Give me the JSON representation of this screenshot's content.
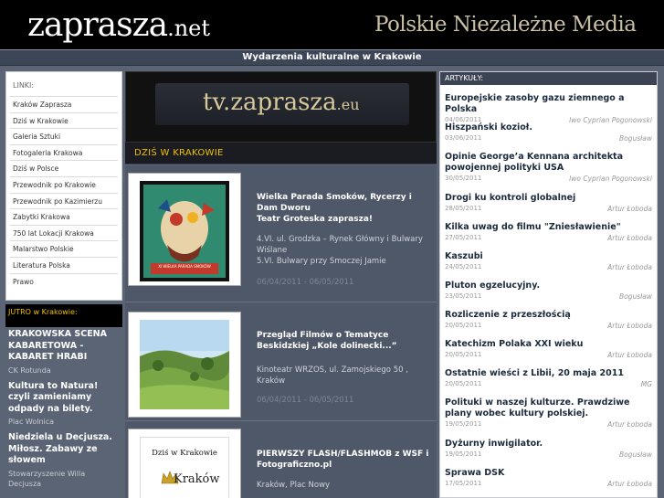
{
  "header": {
    "logo_main": "zaprasza",
    "logo_tld": ".net",
    "slogan": "Polskie Niezależne Media",
    "subtitle": "Wydarzenia kulturalne w Krakowie"
  },
  "links": {
    "title": "LINKI:",
    "items": [
      "Kraków Zaprasza",
      "Dziś w Krakowie",
      "Galeria Sztuki",
      "Fotogaleria Krakowa",
      "Dziś w Polsce",
      "Przewodnik po Krakowie",
      "Przewodnik po Kazimierzu",
      "Zabytki Krakowa",
      "750 lat Lokacji Krakowa",
      "Malarstwo Polskie",
      "Literatura Polska",
      "Prawo"
    ]
  },
  "jutro": {
    "title": "JUTRO w Krakowie:",
    "events": [
      {
        "title": "KRAKOWSKA SCENA KABARETOWA - KABARET HRABI",
        "place": "CK Rotunda"
      },
      {
        "title": "Kultura to Natura! czyli zamieniamy odpady na bilety.",
        "place": "Plac Wolnica"
      },
      {
        "title": "Niedziela u Decjusza. Miłosz. Zabawy ze słowem",
        "place": "Stowarzyszenie Willa Decjusza"
      }
    ]
  },
  "tv": {
    "main": "tv.zaprasza",
    "tld": ".eu"
  },
  "dzis": {
    "title": "DZIŚ W KRAKOWIE",
    "items": [
      {
        "title": "Wielka Parada Smoków, Rycerzy i Dam Dworu",
        "subtitle": "Teatr Groteska zaprasza!",
        "desc": "4.VI. ul. Grodzka – Rynek Główny i Bulwary Wiślane\n5.VI. Bulwary przy Smoczej Jamie",
        "date": "06/04/2011  -  06/05/2011",
        "thumb_caption": "XI WIELKA PARADA SMOKÓW"
      },
      {
        "title": "Przegląd Filmów o Tematyce Beskidzkiej „Kole dolinecki...”",
        "subtitle": "",
        "desc": "Kinoteatr WRZOS, ul. Zamojskiego 50 , Kraków",
        "date": "06/04/2011  -  06/05/2011",
        "thumb_caption": ""
      },
      {
        "title": "PIERWSZY FLASH/FLASHMOB z WSF i Fotograficzno.pl",
        "subtitle": "",
        "desc": "Kraków, Plac Nowy",
        "date": "",
        "thumb_caption": "Dziś w Krakowie",
        "thumb_caption2": "Kraków"
      }
    ]
  },
  "articles": {
    "title": "ARTYKUŁY:",
    "items": [
      {
        "title": "Europejskie zasoby gazu ziemnego a Polska",
        "date": "04/06/2011",
        "author": "Iwo Cyprian Pogonowski"
      },
      {
        "title": "Hiszpański kozioł.",
        "date": "03/06/2011",
        "author": "Bogusław"
      },
      {
        "title": "Opinie George’a Kennana architekta powojennej polityki USA",
        "date": "30/05/2011",
        "author": "Iwo Cyprian Pogonowski"
      },
      {
        "title": "Drogi ku kontroli globalnej",
        "date": "28/05/2011",
        "author": "Artur Łoboda"
      },
      {
        "title": "Kilka uwag do filmu \"Zniesławienie\"",
        "date": "27/05/2011",
        "author": "Artur Łoboda"
      },
      {
        "title": "Kaszubi",
        "date": "24/05/2011",
        "author": "Artur Łoboda"
      },
      {
        "title": "Pluton egzelucyjny.",
        "date": "23/05/2011",
        "author": "Bogusław"
      },
      {
        "title": "Rozliczenie z przeszłością",
        "date": "20/05/2011",
        "author": "Artur Łoboda"
      },
      {
        "title": "Katechizm Polaka XXI wieku",
        "date": "20/05/2011",
        "author": "Artur Łoboda"
      },
      {
        "title": "Ostatnie wieści z Libii, 20 maja 2011",
        "date": "20/05/2011",
        "author": "MG"
      },
      {
        "title": "Polituki w naszej kulturze. Prawdziwe plany wobec kultury polskiej.",
        "date": "19/05/2011",
        "author": "Artur Łoboda"
      },
      {
        "title": "Dyżurny inwigilator.",
        "date": "19/05/2011",
        "author": "Bogusław"
      },
      {
        "title": "Sprawa DSK",
        "date": "17/05/2011",
        "author": "Artur Łoboda"
      }
    ]
  },
  "colors": {
    "header_bg": "#000000",
    "slogan": "#c8bfa6",
    "page_bg": "#5a6474",
    "accent_yellow": "#f0c000",
    "article_title": "#1b2a3c"
  }
}
